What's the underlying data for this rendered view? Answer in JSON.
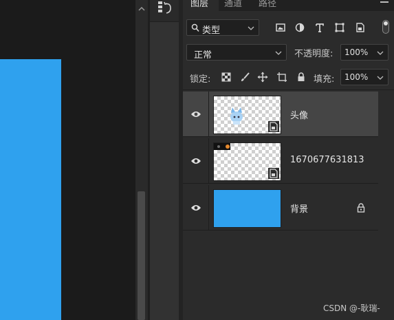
{
  "tabs": [
    {
      "label": "图层"
    },
    {
      "label": "通道"
    },
    {
      "label": "路径"
    }
  ],
  "filter": {
    "kind_label": "类型"
  },
  "blend": {
    "mode": "正常"
  },
  "opacity": {
    "label": "不透明度:",
    "value": "100%"
  },
  "lock": {
    "label": "锁定:"
  },
  "fill": {
    "label": "填充:",
    "value": "100%"
  },
  "layers": [
    {
      "name": "头像",
      "selected": true,
      "smart_object": true,
      "locked": false
    },
    {
      "name": "1670677631813",
      "selected": false,
      "smart_object": true,
      "locked": false
    },
    {
      "name": "背景",
      "selected": false,
      "smart_object": false,
      "locked": true
    }
  ],
  "colors": {
    "canvas_fill": "#2fa1ee",
    "panel_bg": "#2b2b2b",
    "selected_row": "#454545"
  },
  "watermark": "CSDN @-耿瑞-"
}
